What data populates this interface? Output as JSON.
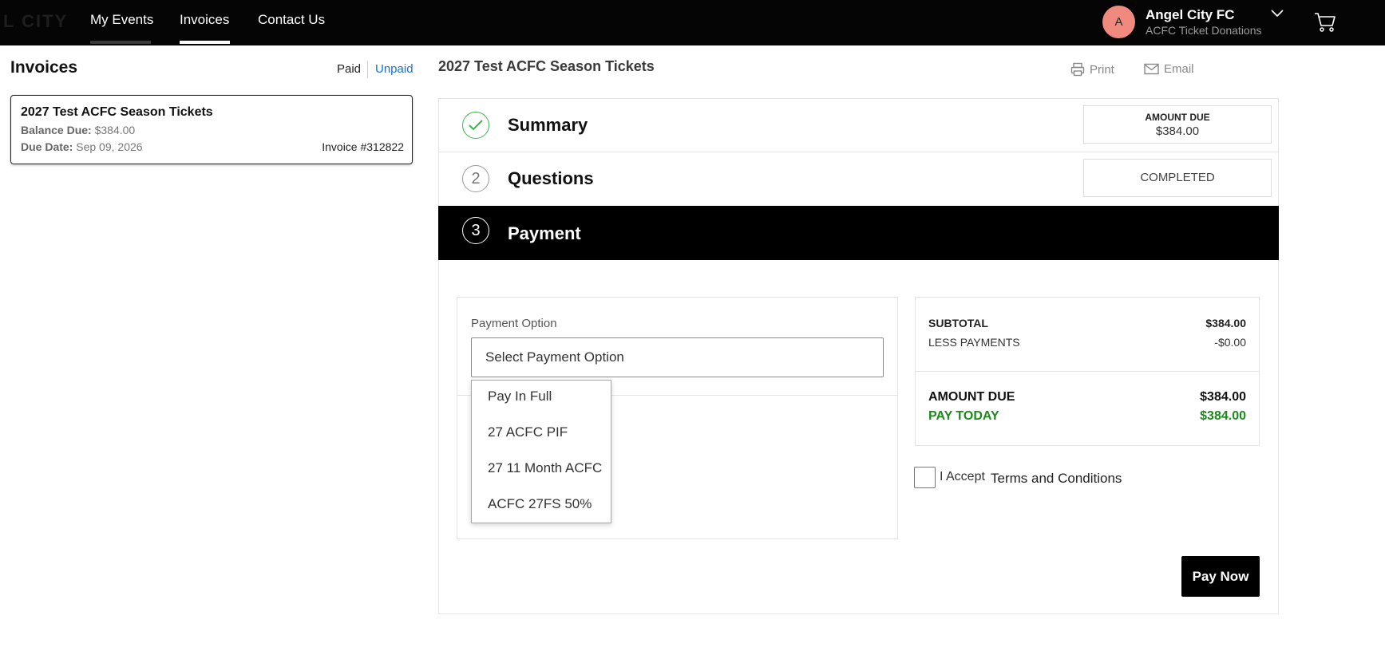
{
  "nav": {
    "brand": "L CITY",
    "links": [
      "My Events",
      "Invoices",
      "Contact Us"
    ],
    "active": "Invoices",
    "user": {
      "initial": "A",
      "name": "Angel City FC",
      "org": "ACFC Ticket Donations"
    },
    "colors": {
      "bar": "#050505",
      "avatar": "#f08a7e",
      "underline_active": "#ffffff",
      "underline_muted": "#555555"
    }
  },
  "sidebar": {
    "title": "Invoices",
    "filters": {
      "paid": "Paid",
      "unpaid": "Unpaid"
    },
    "invoices": [
      {
        "title": "2027 Test ACFC Season Tickets",
        "balance_label": "Balance Due:",
        "balance": "$384.00",
        "due_label": "Due Date:",
        "due_date": "Sep 09, 2026",
        "number": "Invoice #312822"
      }
    ]
  },
  "main": {
    "title": "2027 Test ACFC Season Tickets",
    "print": "Print",
    "email": "Email",
    "steps": [
      {
        "number": "",
        "label": "Summary",
        "status_label": "AMOUNT DUE",
        "status_value": "$384.00",
        "state": "done"
      },
      {
        "number": "2",
        "label": "Questions",
        "status_value": "COMPLETED",
        "state": "done"
      },
      {
        "number": "3",
        "label": "Payment",
        "state": "active"
      }
    ]
  },
  "payment": {
    "option_label": "Payment Option",
    "select_placeholder": "Select Payment Option",
    "options": [
      "Pay In Full",
      "27 ACFC PIF",
      "27 11 Month ACFC",
      "ACFC 27FS 50%"
    ],
    "summary": {
      "subtotal_label": "SUBTOTAL",
      "subtotal": "$384.00",
      "less_label": "LESS PAYMENTS",
      "less": "-$0.00",
      "due_label": "AMOUNT DUE",
      "due": "$384.00",
      "today_label": "PAY TODAY",
      "today": "$384.00"
    },
    "accept_label": "I Accept",
    "terms_label": "Terms and Conditions",
    "pay_button": "Pay Now",
    "colors": {
      "pay_today": "#1a8a1a",
      "check": "#3bb54a",
      "link": "#1a6fd0"
    }
  }
}
